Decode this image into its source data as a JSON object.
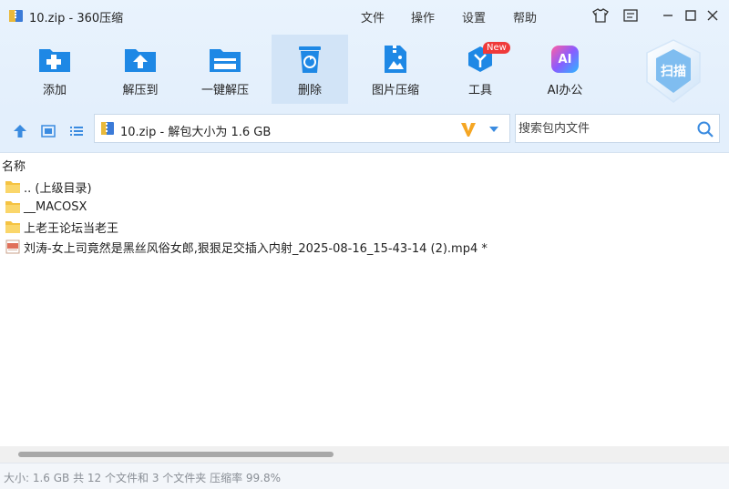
{
  "window": {
    "title": "10.zip - 360压缩",
    "menu": [
      "文件",
      "操作",
      "设置",
      "帮助"
    ]
  },
  "toolbar": {
    "items": [
      {
        "label": "添加",
        "icon": "add-file-icon"
      },
      {
        "label": "解压到",
        "icon": "extract-to-icon"
      },
      {
        "label": "一键解压",
        "icon": "one-click-extract-icon"
      },
      {
        "label": "删除",
        "icon": "delete-icon"
      },
      {
        "label": "图片压缩",
        "icon": "image-compress-icon"
      },
      {
        "label": "工具",
        "icon": "tools-icon",
        "badge": "New"
      },
      {
        "label": "AI办公",
        "icon": "ai-office-icon",
        "icon_text": "AI"
      }
    ],
    "scan_label": "扫描"
  },
  "address": {
    "path": "10.zip - 解包大小为 1.6 GB"
  },
  "search": {
    "placeholder": "搜索包内文件"
  },
  "list": {
    "column_name": "名称",
    "rows": [
      {
        "name": ".. (上级目录)",
        "type": "folder"
      },
      {
        "name": "__MACOSX",
        "type": "folder"
      },
      {
        "name": "上老王论坛当老王",
        "type": "folder"
      },
      {
        "name": "刘涛-女上司竟然是黑丝风俗女郎,狠狠足交插入内射_2025-08-16_15-43-14 (2).mp4 *",
        "type": "mp4"
      }
    ]
  },
  "status": {
    "text": "大小: 1.6 GB 共 12 个文件和 3 个文件夹 压缩率 99.8%"
  },
  "colors": {
    "accent": "#1e88e5",
    "toolbar_bg": "#e3effc",
    "folder": "#f5c342"
  }
}
